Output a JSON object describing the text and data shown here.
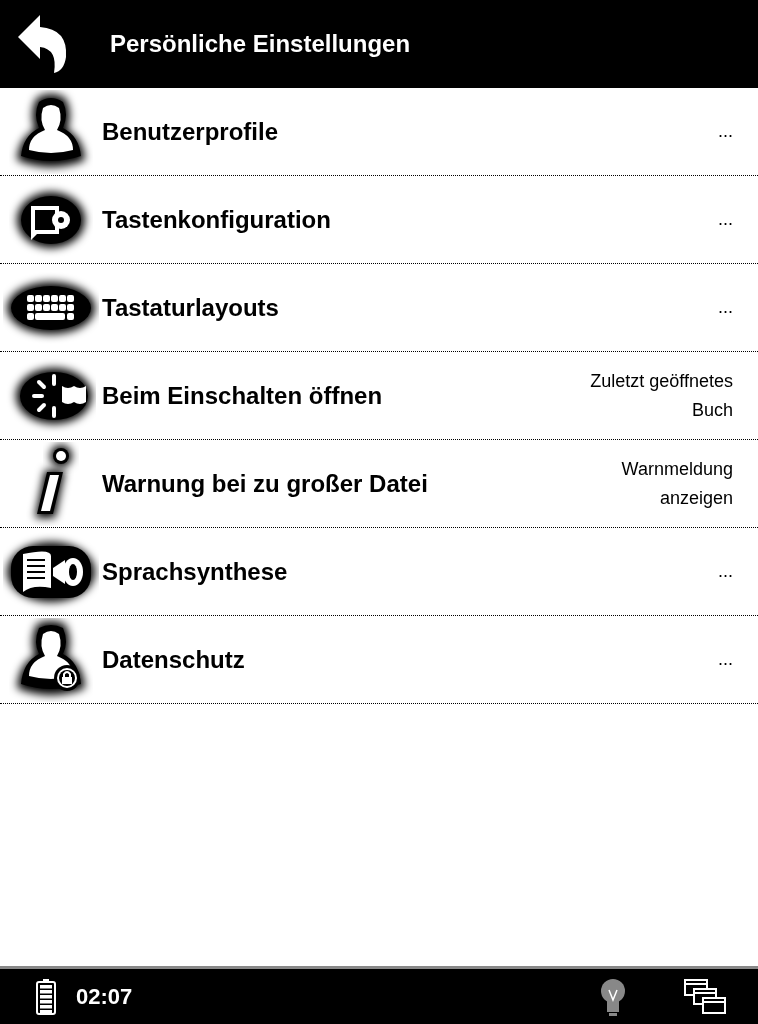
{
  "header": {
    "title": "Persönliche Einstellungen"
  },
  "items": [
    {
      "kind": "person",
      "label": "Benutzerprofile",
      "value": "..."
    },
    {
      "kind": "keys",
      "label": "Tastenkonfiguration",
      "value": "..."
    },
    {
      "kind": "keyboard",
      "label": "Tastaturlayouts",
      "value": "..."
    },
    {
      "kind": "power",
      "label": "Beim Einschalten öffnen",
      "value": "Zuletzt geöffnetes Buch"
    },
    {
      "kind": "info",
      "label": "Warnung bei zu großer Datei",
      "value": "Warnmeldung anzeigen"
    },
    {
      "kind": "speech",
      "label": "Sprachsynthese",
      "value": "..."
    },
    {
      "kind": "privacy",
      "label": "Datenschutz",
      "value": "..."
    }
  ],
  "status_bar": {
    "time": "02:07"
  }
}
